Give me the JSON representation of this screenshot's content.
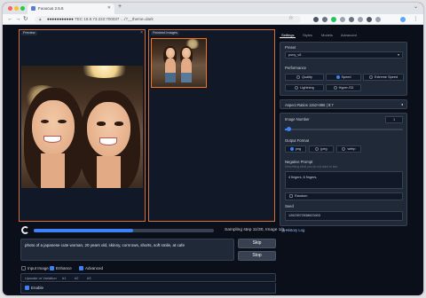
{
  "browser": {
    "tab_title": "Fooocus 2.5.5",
    "url_host": "●●●●●●●●●●●",
    "url_path": "TEC 18.8.73.222:700037 …/?__theme=dark",
    "colors": {
      "close": "#ff5f57",
      "minimize": "#febc2e",
      "maximize": "#28c840",
      "accent": "#d2703d"
    }
  },
  "preview_panel": {
    "label": "Preview"
  },
  "gallery_panel": {
    "label": "Finished Images"
  },
  "progress": {
    "text": "Sampling step 11/30, Image 1/1...",
    "fraction": 0.55
  },
  "prompt": {
    "value": "photo of a japanese cute woman, 20 years old, skinny, cornrows, shorts, soft smile, at cafe",
    "skip_label": "Skip",
    "stop_label": "Stop"
  },
  "checkboxes": [
    {
      "label": "Input Image",
      "checked": false
    },
    {
      "label": "Enhance",
      "checked": true
    },
    {
      "label": "Advanced",
      "checked": true
    }
  ],
  "upscale_bar": {
    "label": "Upscale or Variation",
    "tabs": [
      "#1",
      "#2",
      "#3"
    ]
  },
  "enable": {
    "label": "Enable"
  },
  "settings": {
    "tabs": [
      "Settings",
      "Styles",
      "Models",
      "Advanced"
    ],
    "preset_label": "Preset",
    "preset_value": "pony_v6",
    "performance_label": "Performance",
    "performance_options": [
      "Quality",
      "Speed",
      "Extreme Speed",
      "Lightning",
      "Hyper-SD"
    ],
    "performance_selected": "Speed",
    "aspect_label": "Aspect Ratios 1152×896 | 9:7",
    "image_number_label": "Image Number",
    "image_number_value": "1",
    "image_number_fraction": 0.03,
    "format_label": "Output Format",
    "format_options": [
      "png",
      "jpeg",
      "webp"
    ],
    "format_selected": "png",
    "negative_label": "Negative Prompt",
    "negative_hint": "Describing what you do not want to see.",
    "negative_value": "4 fingers, 6 fingers,",
    "random_label": "Random",
    "seed_label": "Seed",
    "seed_value": "12623972538623403",
    "history_link": "History Log"
  }
}
